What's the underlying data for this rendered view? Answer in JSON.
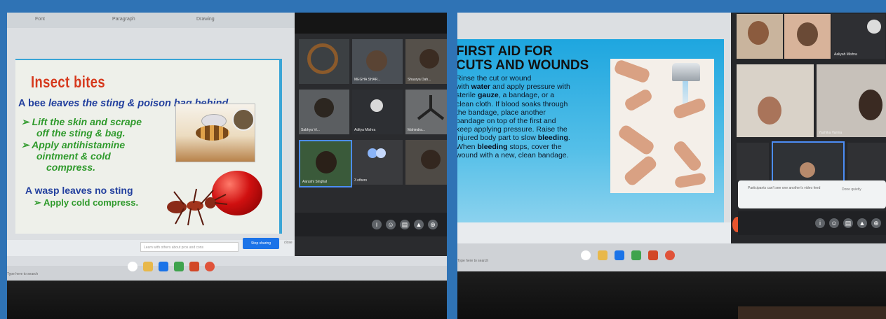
{
  "left_photo": {
    "ribbon_tabs": [
      "Font",
      "Paragraph",
      "Drawing"
    ],
    "slide": {
      "title": "Insect bites",
      "subtitle_prefix": "A bee ",
      "subtitle_emphasis": "leaves the sting & poison bag behind",
      "bullet_1_line_1": "➢ Lift the skin and scrape",
      "bullet_1_line_2": "off the sting & bag.",
      "bullet_2_line_1": "➢ Apply antihistamine",
      "bullet_2_line_2": "ointment & cold",
      "bullet_2_line_3": "compress.",
      "wasp_heading": "A wasp leaves no sting",
      "wasp_bullet": "➢ Apply cold compress."
    },
    "meet_tiles": [
      {
        "name": ""
      },
      {
        "name": "MEGHA SHAR..."
      },
      {
        "name": "Shaurya Dah..."
      },
      {
        "name": "Sabhya Vi..."
      },
      {
        "name": "Aditya Mishra"
      },
      {
        "name": "Mahindra..."
      },
      {
        "name": "Aarushi Singhal"
      },
      {
        "name": "3 others"
      },
      {
        "name": ""
      }
    ],
    "tile_icon": "mic-off-icon",
    "status_input": "Learn with others about pros and cons",
    "status_button": "Stop sharing",
    "status_close": "close",
    "search_text": "Type here to search",
    "meet_controls": [
      "info-icon",
      "people-icon",
      "chat-icon",
      "activities-icon",
      "lock-icon"
    ],
    "taskbar_icons": [
      "search-icon",
      "file-explorer-icon",
      "mail-icon",
      "chrome-icon",
      "powerpoint-icon",
      "record-icon"
    ]
  },
  "right_photo": {
    "slide": {
      "title_line_1": "FIRST AID FOR",
      "title_line_2": "CUTS AND WOUNDS",
      "b_1": "Rinse the cut or wound",
      "b_2": "with ",
      "b_3": "water",
      "b_4": " and apply pressure with",
      "b_5": "sterile ",
      "b_6": "gauze",
      "b_7": ", a bandage, or a",
      "b_8": "clean cloth. If blood soaks through",
      "b_9": "the bandage, place another",
      "b_10": "bandage on top of the first and",
      "b_11": "keep applying pressure. Raise the",
      "b_12": "injured body part to slow ",
      "b_13": "bleeding",
      "b_14": ".",
      "b_15": "When ",
      "b_16": "bleeding",
      "b_17": " stops, cover the",
      "b_18": "wound with a new, clean bandage."
    },
    "meet_tiles": [
      {
        "name": ""
      },
      {
        "name": ""
      },
      {
        "name": "Aaliyah Mishra"
      },
      {
        "name": ""
      },
      {
        "name": "Yashika Varma"
      },
      {
        "name": ""
      },
      {
        "name": ""
      },
      {
        "name": ""
      }
    ],
    "chat_text": "Participants can't see one another's video feed",
    "chat_link": "Done quietly",
    "search_text": "Type here to search",
    "meet_controls": [
      "info-icon",
      "people-icon",
      "chat-icon",
      "activities-icon",
      "lock-icon"
    ],
    "taskbar_icons": [
      "search-icon",
      "file-explorer-icon",
      "mail-icon",
      "chrome-icon",
      "powerpoint-icon",
      "record-icon"
    ]
  }
}
